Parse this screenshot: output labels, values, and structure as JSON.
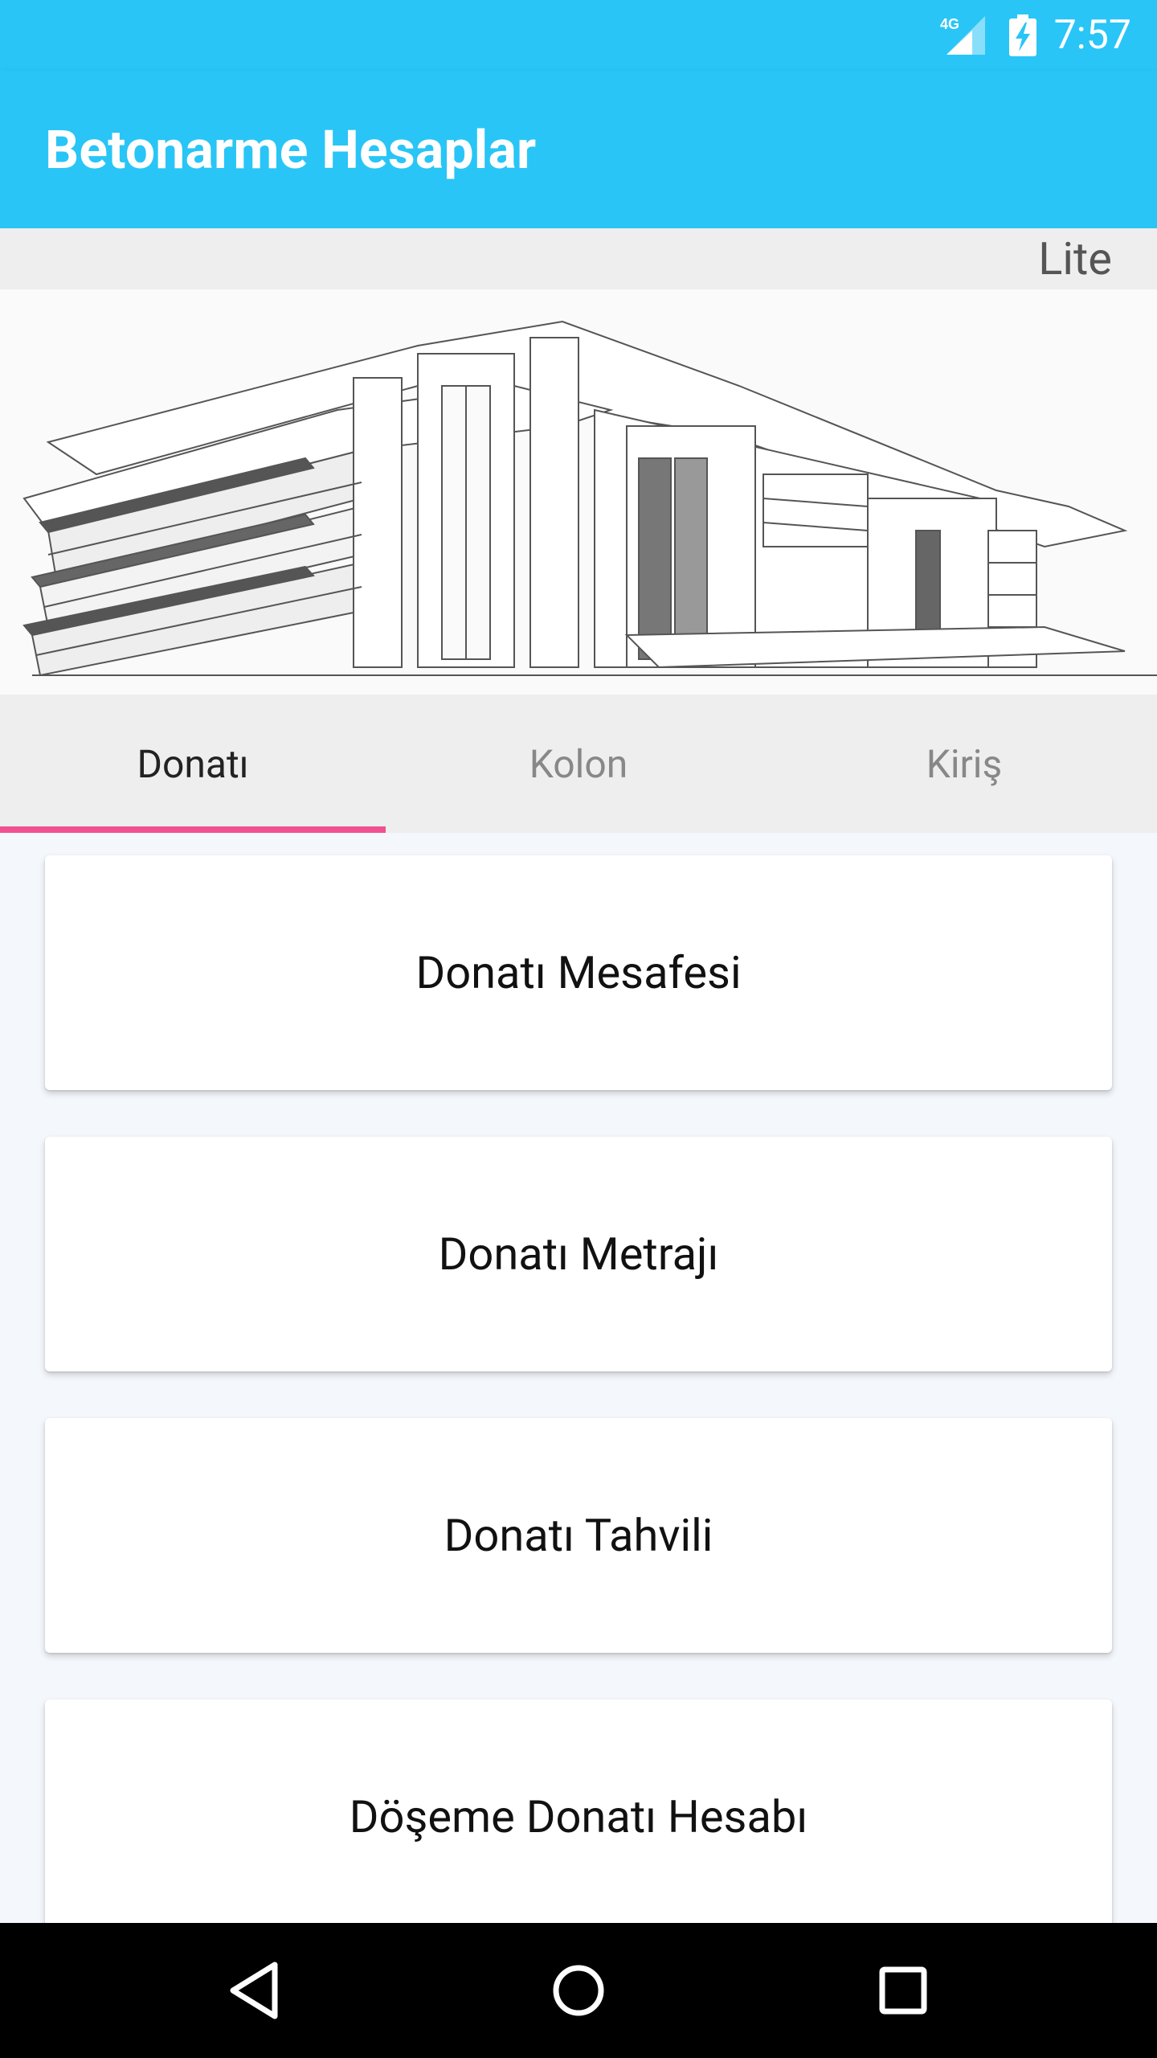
{
  "status": {
    "time": "7:57",
    "network": "4G"
  },
  "app": {
    "title": "Betonarme Hesaplar",
    "edition": "Lite"
  },
  "hero": {
    "description": "building-sketch-illustration"
  },
  "tabs": [
    {
      "label": "Donatı",
      "active": true
    },
    {
      "label": "Kolon",
      "active": false
    },
    {
      "label": "Kiriş",
      "active": false
    }
  ],
  "cards": [
    {
      "label": "Donatı Mesafesi"
    },
    {
      "label": "Donatı Metrajı"
    },
    {
      "label": "Donatı Tahvili"
    },
    {
      "label": "Döşeme Donatı Hesabı"
    }
  ],
  "colors": {
    "primary": "#29c5f6",
    "indicator": "#f0508f",
    "tabbar": "#eeeeee"
  },
  "icons": [
    "signal-icon",
    "battery-charging-icon",
    "back-icon",
    "home-icon",
    "recents-icon"
  ]
}
